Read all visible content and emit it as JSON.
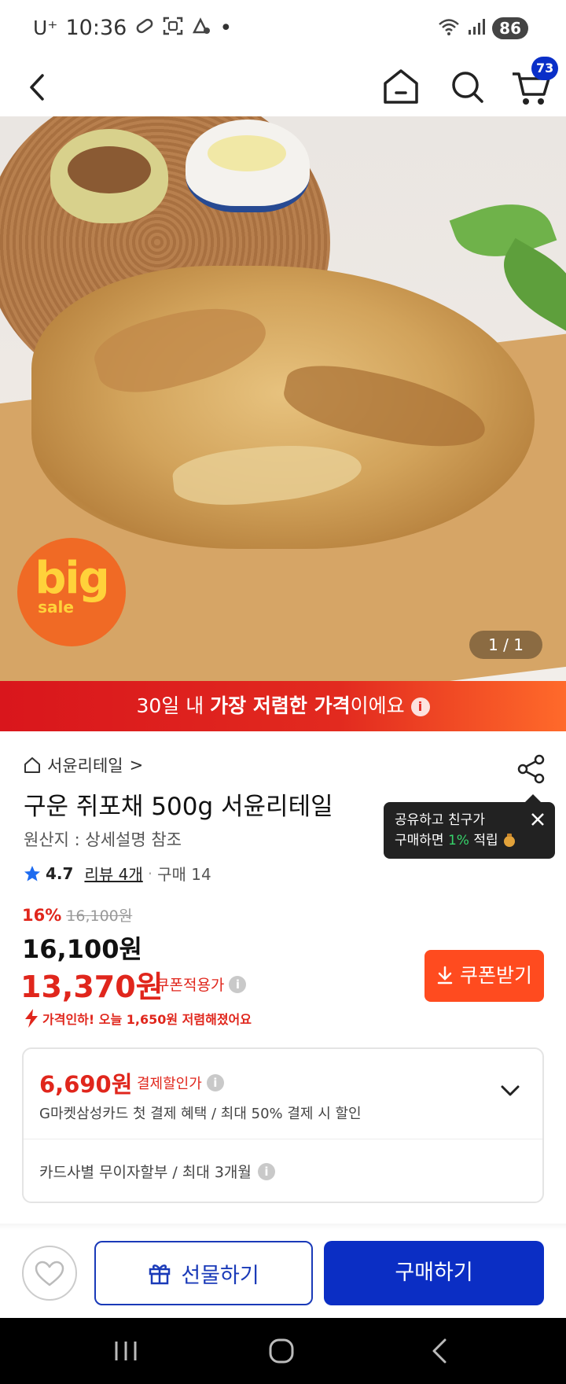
{
  "status_bar": {
    "carrier": "U⁺",
    "time": "10:36",
    "dot": "•",
    "battery": "86"
  },
  "header": {
    "cart_count": "73"
  },
  "hero": {
    "badge_big": "big",
    "badge_sale": "sale",
    "pager": "1 / 1"
  },
  "banner": {
    "prefix": "30일 내 ",
    "highlight": "가장 저렴한 가격",
    "suffix": "이에요"
  },
  "product": {
    "seller": "서윤리테일",
    "seller_arrow": ">",
    "title": "구운 쥐포채 500g 서윤리테일",
    "origin": "원산지 : 상세설명 참조",
    "rating": "4.7",
    "review": "리뷰 4개",
    "purchase": "구매 14",
    "rating_sep": "·"
  },
  "tooltip": {
    "line1": "공유하고 친구가",
    "line2_a": "구매하면 ",
    "line2_pct": "1%",
    "line2_b": " 적립"
  },
  "price": {
    "discount": "16%",
    "original": "16,100원",
    "sale": "16,100원",
    "coupon_price": "13,370원",
    "coupon_label": "쿠폰적용가",
    "coupon_button": "쿠폰받기",
    "price_drop": "가격인하! 오늘 1,650원 저렴해졌어요"
  },
  "payment": {
    "price": "6,690원",
    "label": "결제할인가",
    "desc": "G마켓삼성카드 첫 결제 혜택 / 최대 50% 결제 시 할인",
    "installment": "카드사별 무이자할부 / 최대 3개월"
  },
  "actions": {
    "gift": "선물하기",
    "buy": "구매하기"
  },
  "colors": {
    "accent_red": "#e0261c",
    "brand_blue": "#0b2ec4",
    "coupon_orange": "#ff4b1f"
  }
}
